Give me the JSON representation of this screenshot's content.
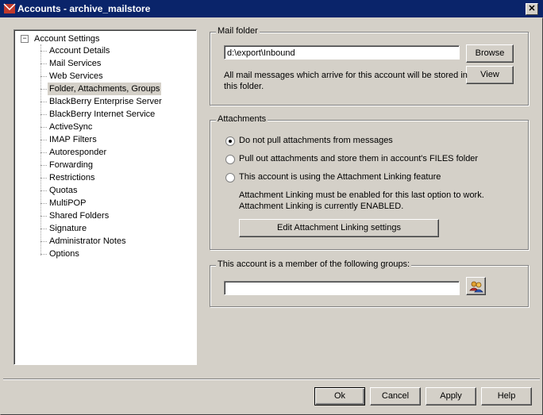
{
  "window": {
    "title": "Accounts - archive_mailstore",
    "close_glyph": "✕"
  },
  "tree": {
    "root_label": "Account Settings",
    "expander": "−",
    "items": [
      "Account Details",
      "Mail Services",
      "Web Services",
      "Folder, Attachments, Groups",
      "BlackBerry Enterprise Server",
      "BlackBerry Internet Service",
      "ActiveSync",
      "IMAP Filters",
      "Autoresponder",
      "Forwarding",
      "Restrictions",
      "Quotas",
      "MultiPOP",
      "Shared Folders",
      "Signature",
      "Administrator Notes",
      "Options"
    ],
    "selected": "Folder, Attachments, Groups"
  },
  "mail_folder": {
    "label": "Mail folder",
    "path": "d:\\export\\Inbound",
    "browse": "Browse",
    "view": "View",
    "note_line1": "All mail messages which arrive for this account will be stored in",
    "note_line2": "this folder."
  },
  "attachments": {
    "label": "Attachments",
    "options": [
      "Do not pull attachments from messages",
      "Pull out attachments and store them in account's FILES folder",
      "This account is using the Attachment Linking feature"
    ],
    "selected_index": 0,
    "note_line1": "Attachment Linking must be enabled for this last option to work.",
    "note_line2": "Attachment Linking is currently ENABLED.",
    "edit_button": "Edit Attachment Linking settings"
  },
  "groups": {
    "label": "This account is a member of the following groups:",
    "value": ""
  },
  "footer": {
    "ok": "Ok",
    "cancel": "Cancel",
    "apply": "Apply",
    "help": "Help"
  }
}
